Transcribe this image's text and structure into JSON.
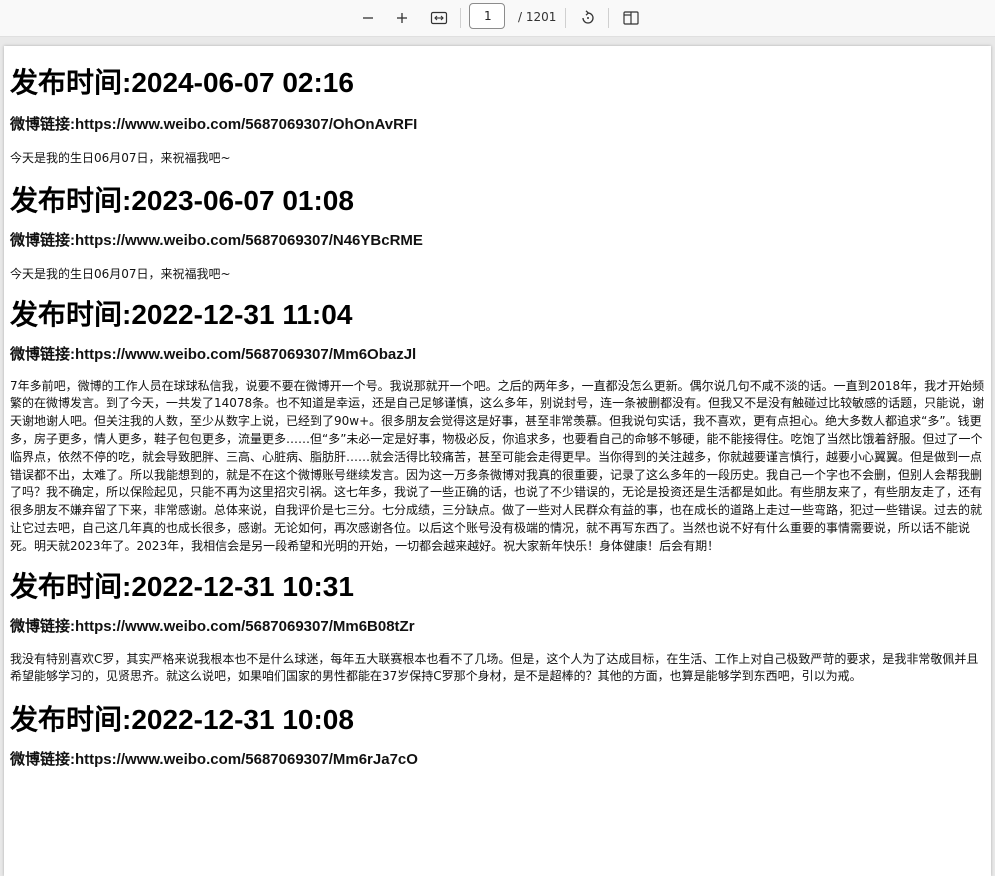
{
  "toolbar": {
    "zoom_out_label": "−",
    "zoom_in_label": "+",
    "page_number": "1",
    "page_total": "/ 1201",
    "icons": [
      "minus-icon",
      "plus-icon",
      "fit-width-icon",
      "rotate-icon",
      "two-page-icon"
    ]
  },
  "posts": [
    {
      "time": "发布时间:2024-06-07 02:16",
      "link": "微博链接:https://www.weibo.com/5687069307/OhOnAvRFI",
      "text": "今天是我的生日06月07日，来祝福我吧~"
    },
    {
      "time": "发布时间:2023-06-07 01:08",
      "link": "微博链接:https://www.weibo.com/5687069307/N46YBcRME",
      "text": "今天是我的生日06月07日，来祝福我吧~"
    },
    {
      "time": "发布时间:2022-12-31 11:04",
      "link": "微博链接:https://www.weibo.com/5687069307/Mm6ObazJl",
      "text": "7年多前吧，微博的工作人员在球球私信我，说要不要在微博开一个号。我说那就开一个吧。之后的两年多，一直都没怎么更新。偶尔说几句不咸不淡的话。一直到2018年，我才开始频繁的在微博发言。到了今天，一共发了14078条。也不知道是幸运，还是自己足够谨慎，这么多年，别说封号，连一条被删都没有。但我又不是没有触碰过比较敏感的话题，只能说，谢天谢地谢人吧。但关注我的人数，至少从数字上说，已经到了90w+。很多朋友会觉得这是好事，甚至非常羡慕。但我说句实话，我不喜欢，更有点担心。绝大多数人都追求“多”。钱更多，房子更多，情人更多，鞋子包包更多，流量更多……但“多”未必一定是好事，物极必反，你追求多，也要看自己的命够不够硬，能不能接得住。吃饱了当然比饿着舒服。但过了一个临界点，依然不停的吃，就会导致肥胖、三高、心脏病、脂肪肝……就会活得比较痛苦，甚至可能会走得更早。当你得到的关注越多，你就越要谨言慎行，越要小心翼翼。但是做到一点错误都不出，太难了。所以我能想到的，就是不在这个微博账号继续发言。因为这一万多条微博对我真的很重要，记录了这么多年的一段历史。我自己一个字也不会删，但别人会帮我删了吗？我不确定，所以保险起见，只能不再为这里招灾引祸。这七年多，我说了一些正确的话，也说了不少错误的，无论是投资还是生活都是如此。有些朋友来了，有些朋友走了，还有很多朋友不嫌弃留了下来，非常感谢。总体来说，自我评价是七三分。七分成绩，三分缺点。做了一些对人民群众有益的事，也在成长的道路上走过一些弯路，犯过一些错误。过去的就让它过去吧，自己这几年真的也成长很多，感谢。无论如何，再次感谢各位。以后这个账号没有极端的情况，就不再写东西了。当然也说不好有什么重要的事情需要说，所以话不能说死。明天就2023年了。2023年，我相信会是另一段希望和光明的开始，一切都会越来越好。祝大家新年快乐！身体健康！后会有期！"
    },
    {
      "time": "发布时间:2022-12-31 10:31",
      "link": "微博链接:https://www.weibo.com/5687069307/Mm6B08tZr",
      "text": "我没有特别喜欢C罗，其实严格来说我根本也不是什么球迷，每年五大联赛根本也看不了几场。但是，这个人为了达成目标，在生活、工作上对自己极致严苛的要求，是我非常敬佩并且希望能够学习的，见贤思齐。就这么说吧，如果咱们国家的男性都能在37岁保持C罗那个身材，是不是超棒的？其他的方面，也算是能够学到东西吧，引以为戒。"
    },
    {
      "time": "发布时间:2022-12-31 10:08",
      "link": "微博链接:https://www.weibo.com/5687069307/Mm6rJa7cO",
      "text": ""
    }
  ]
}
